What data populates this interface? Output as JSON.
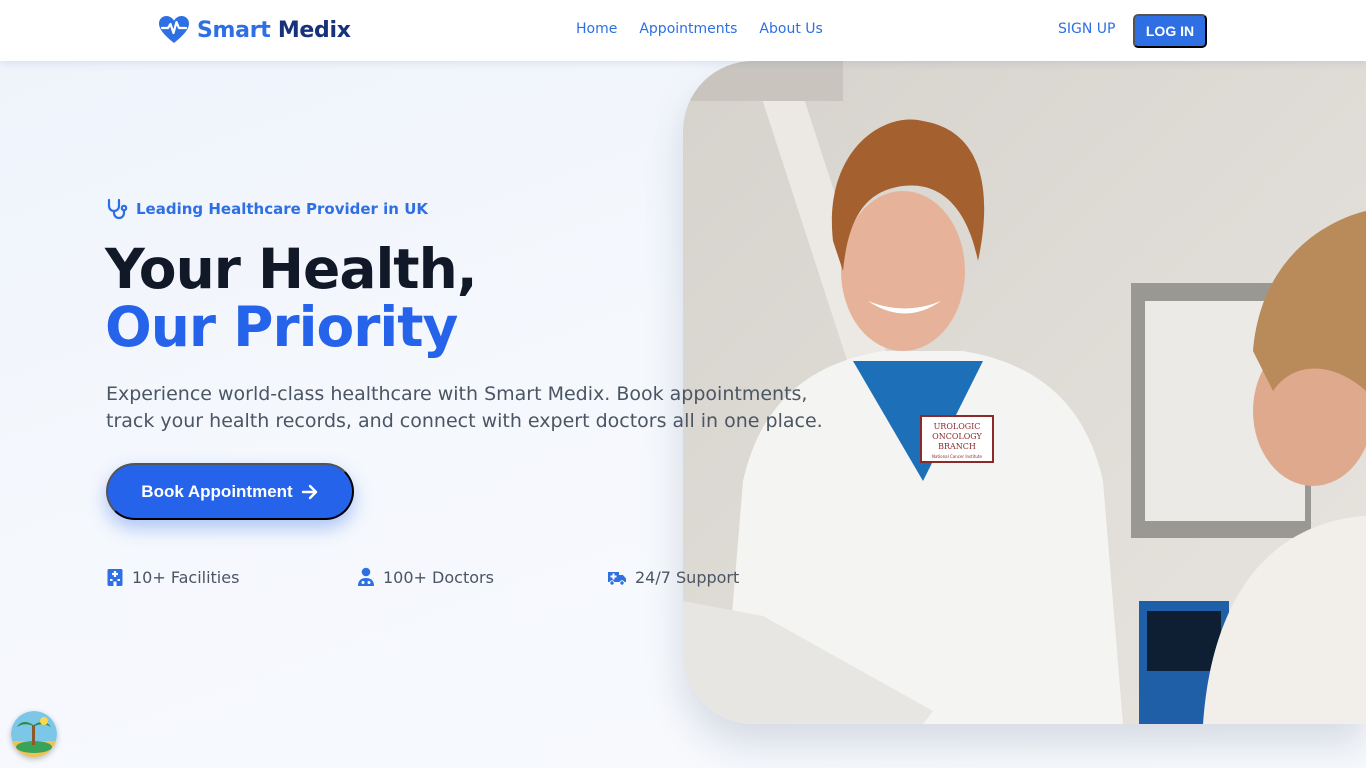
{
  "brand": {
    "part1": "Smart",
    "part2": "Medix",
    "icon": "heart-pulse-icon",
    "color_primary": "#2f6fe4",
    "color_dark": "#17327a"
  },
  "nav": {
    "links": [
      {
        "label": "Home"
      },
      {
        "label": "Appointments"
      },
      {
        "label": "About Us"
      }
    ],
    "signup_label": "SIGN UP",
    "login_label": "LOG IN"
  },
  "hero": {
    "tag": {
      "icon": "stethoscope-icon",
      "text": "Leading Healthcare Provider in UK"
    },
    "headline_line1": "Your Health,",
    "headline_line2": "Our Priority",
    "subtitle": "Experience world-class healthcare with Smart Medix. Book appointments, track your health records, and connect with expert doctors all in one place.",
    "cta_label": "Book Appointment",
    "cta_icon": "arrow-right-icon",
    "stats": [
      {
        "icon": "hospital-icon",
        "text": "10+ Facilities"
      },
      {
        "icon": "doctor-icon",
        "text": "100+ Doctors"
      },
      {
        "icon": "ambulance-icon",
        "text": "24/7 Support"
      }
    ],
    "photo_badge": {
      "line1": "UROLOGIC",
      "line2": "ONCOLOGY",
      "line3": "BRANCH",
      "line4": "National Cancer Institute"
    }
  },
  "colors": {
    "accent": "#2563eb",
    "text_dark": "#111827",
    "text_muted": "#4b5563"
  }
}
